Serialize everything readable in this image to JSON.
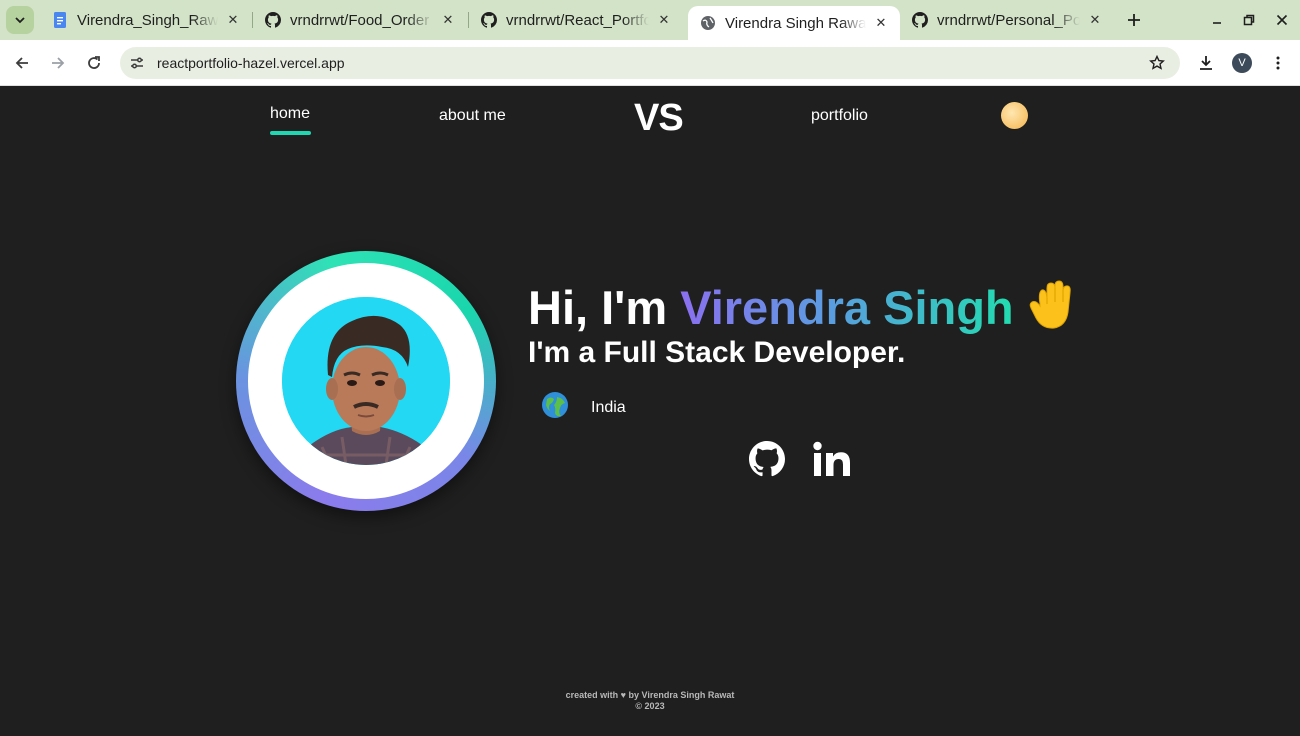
{
  "browser": {
    "tabs": [
      {
        "title": "Virendra_Singh_Rawat",
        "favicon": "google-docs-icon"
      },
      {
        "title": "vrndrrwt/Food_Order",
        "favicon": "github-icon"
      },
      {
        "title": "vrndrrwt/React_Portfolio",
        "favicon": "github-icon"
      },
      {
        "title": "Virendra Singh Rawat",
        "favicon": "globe-icon",
        "active": true
      },
      {
        "title": "vrndrrwt/Personal_Portfolio",
        "favicon": "github-icon"
      }
    ],
    "url": "reactportfolio-hazel.vercel.app",
    "profile_initial": "V"
  },
  "nav": {
    "home": "home",
    "about": "about me",
    "logo": "VS",
    "portfolio": "portfolio",
    "theme_icon": "moon-icon"
  },
  "hero": {
    "greeting_prefix": "Hi, I'm ",
    "name": "Virendra Singh",
    "subtitle": "I'm a Full Stack Developer.",
    "location": "India"
  },
  "footer": {
    "line1": "created with ♥ by Virendra Singh Rawat",
    "line2": "© 2023"
  },
  "colors": {
    "page_bg": "#1f1f1f",
    "accent_teal": "#1fd7b0",
    "accent_purple": "#8b6ff0",
    "photo_bg": "#22d8f2"
  }
}
